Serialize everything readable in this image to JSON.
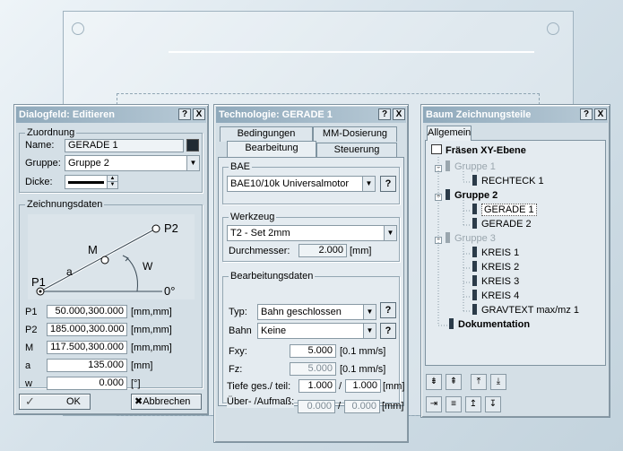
{
  "dialog_edit": {
    "title": "Dialogfeld: Editieren",
    "zuordnung": {
      "title": "Zuordnung",
      "name_label": "Name:",
      "name_value": "GERADE 1",
      "gruppe_label": "Gruppe:",
      "gruppe_value": "Gruppe 2",
      "dicke_label": "Dicke:"
    },
    "zeichnung": {
      "title": "Zeichnungsdaten",
      "diagram_labels": {
        "p1": "P1",
        "p2": "P2",
        "m": "M",
        "a": "a",
        "w": "W",
        "zero": "0°"
      },
      "rows": [
        {
          "label": "P1",
          "value": "50.000,300.000",
          "unit": "[mm,mm]"
        },
        {
          "label": "P2",
          "value": "185.000,300.000",
          "unit": "[mm,mm]"
        },
        {
          "label": "M",
          "value": "117.500,300.000",
          "unit": "[mm,mm]"
        },
        {
          "label": "a",
          "value": "135.000",
          "unit": "[mm]"
        },
        {
          "label": "w",
          "value": "0.000",
          "unit": "[°]"
        }
      ]
    },
    "ok_label": "OK",
    "cancel_label": "Abbrechen"
  },
  "technology": {
    "title": "Technologie: GERADE 1",
    "tabs": {
      "bedingungen": "Bedingungen",
      "mm_dosierung": "MM-Dosierung",
      "bearbeitung": "Bearbeitung",
      "steuerung": "Steuerung"
    },
    "bae": {
      "title": "BAE",
      "value": "BAE10/10k Universalmotor"
    },
    "werkzeug": {
      "title": "Werkzeug",
      "value": "T2 - Set 2mm",
      "durchmesser_label": "Durchmesser:",
      "durchmesser_value": "2.000",
      "durchmesser_unit": "[mm]"
    },
    "bearbeitungsdaten": {
      "title": "Bearbeitungsdaten",
      "typ_label": "Typ:",
      "typ_value": "Bahn geschlossen",
      "bahn_label": "Bahn",
      "bahn_value": "Keine",
      "fxy_label": "Fxy:",
      "fxy_value": "5.000",
      "fxy_unit": "[0.1 mm/s]",
      "fz_label": "Fz:",
      "fz_value": "5.000",
      "fz_unit": "[0.1 mm/s]",
      "tiefe_label": "Tiefe ges./ teil:",
      "tiefe_value1": "1.000",
      "tiefe_value2": "1.000",
      "tiefe_unit": "[mm]",
      "aufmass_label": "Über- /Aufmaß:",
      "aufmass_value1": "0.000",
      "aufmass_value2": "0.000",
      "aufmass_unit": "[mm]",
      "slash": "/"
    },
    "q_label": "?"
  },
  "tree": {
    "title": "Baum Zeichnungsteile",
    "tab": "Allgemein",
    "root": "Fräsen XY-Ebene",
    "gruppe1": "Gruppe 1",
    "rechteck1": "RECHTECK 1",
    "gruppe2": "Gruppe 2",
    "gerade1": "GERADE 1",
    "gerade2": "GERADE 2",
    "gruppe3": "Gruppe 3",
    "kreis1": "KREIS 1",
    "kreis2": "KREIS 2",
    "kreis3": "KREIS 3",
    "kreis4": "KREIS 4",
    "gravtext": "GRAVTEXT max/mz 1",
    "dokumentation": "Dokumentation"
  },
  "window_buttons": {
    "help": "?",
    "close": "X"
  }
}
